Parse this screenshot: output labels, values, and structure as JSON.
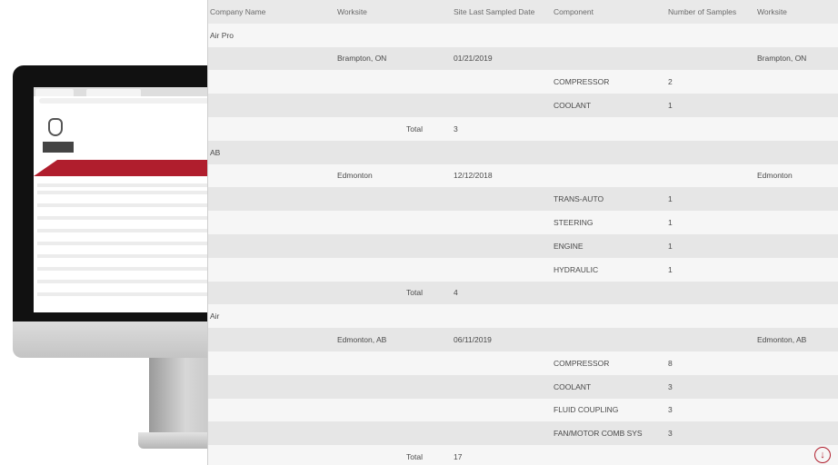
{
  "table": {
    "headers": {
      "company": "Company Name",
      "worksite": "Worksite",
      "date": "Site Last Sampled Date",
      "component": "Component",
      "count": "Number of Samples",
      "worksite2": "Worksite"
    },
    "total_label": "Total",
    "groups": [
      {
        "company": "Air Pro",
        "worksite": "Brampton, ON",
        "date": "01/21/2019",
        "worksite2": "Brampton, ON",
        "components": [
          {
            "name": "COMPRESSOR",
            "count": "2"
          },
          {
            "name": "COOLANT",
            "count": "1"
          }
        ],
        "total": "3"
      },
      {
        "company": "AB",
        "worksite": "Edmonton",
        "date": "12/12/2018",
        "worksite2": "Edmonton",
        "components": [
          {
            "name": "TRANS-AUTO",
            "count": "1"
          },
          {
            "name": "STEERING",
            "count": "1"
          },
          {
            "name": "ENGINE",
            "count": "1"
          },
          {
            "name": "HYDRAULIC",
            "count": "1"
          }
        ],
        "total": "4"
      },
      {
        "company": "Air",
        "worksite": "Edmonton, AB",
        "date": "06/11/2019",
        "worksite2": "Edmonton, AB",
        "components": [
          {
            "name": "COMPRESSOR",
            "count": "8"
          },
          {
            "name": "COOLANT",
            "count": "3"
          },
          {
            "name": "FLUID COUPLING",
            "count": "3"
          },
          {
            "name": "FAN/MOTOR COMB SYS",
            "count": "3"
          }
        ],
        "total": "17"
      }
    ]
  },
  "icons": {
    "download": "download-icon",
    "logo": "bureau-veritas-logo"
  },
  "colors": {
    "brand_red": "#b01e2d",
    "row_shade": "#e6e6e6"
  }
}
